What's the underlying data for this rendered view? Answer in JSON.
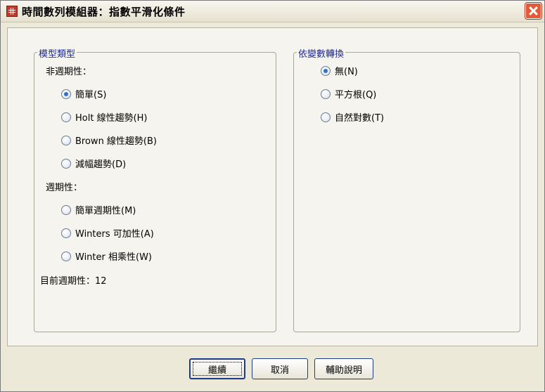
{
  "window": {
    "title": "時間數列模組器：指數平滑化條件"
  },
  "model_type": {
    "legend": "模型類型",
    "nonseasonal_heading": "非週期性：",
    "nonseasonal_options": [
      {
        "label": "簡單(S)",
        "checked": true
      },
      {
        "label": "Holt 線性趨勢(H)",
        "checked": false
      },
      {
        "label": "Brown 線性趨勢(B)",
        "checked": false
      },
      {
        "label": "減幅趨勢(D)",
        "checked": false
      }
    ],
    "seasonal_heading": "週期性：",
    "seasonal_options": [
      {
        "label": "簡單週期性(M)",
        "checked": false
      },
      {
        "label": "Winters 可加性(A)",
        "checked": false
      },
      {
        "label": "Winter 相乘性(W)",
        "checked": false
      }
    ],
    "current_periodicity": "目前週期性：12"
  },
  "dependent_transform": {
    "legend": "依變數轉換",
    "options": [
      {
        "label": "無(N)",
        "checked": true
      },
      {
        "label": "平方根(Q)",
        "checked": false
      },
      {
        "label": "自然對數(T)",
        "checked": false
      }
    ]
  },
  "buttons": {
    "continue": "繼續",
    "cancel": "取消",
    "help": "輔助說明"
  },
  "colors": {
    "dialog_bg": "#ece9d8",
    "panel_bg": "#f5f4ee",
    "legend_text": "#1f2a8a",
    "close_button": "#e15b3a",
    "radio_dot": "#2f6fd0"
  }
}
